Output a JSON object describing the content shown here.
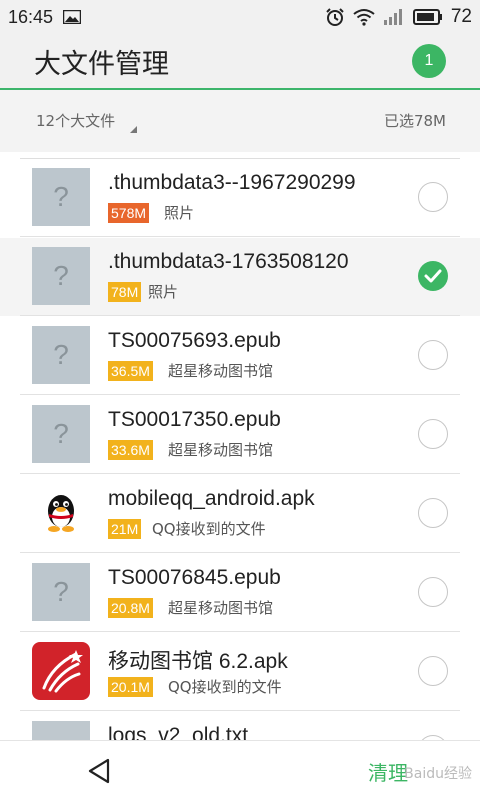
{
  "status_bar": {
    "time": "16:45",
    "battery": "72",
    "icons": [
      "image-icon",
      "alarm-icon",
      "wifi-icon",
      "signal-icon",
      "battery-icon"
    ]
  },
  "header": {
    "title": "大文件管理",
    "badge_count": "1"
  },
  "summary": {
    "file_count_label": "12个大文件",
    "selected_label": "已选78M"
  },
  "files": [
    {
      "name": ".thumbdata3--1967290299",
      "size": "578M",
      "size_color": "#e8662c",
      "source": "照片",
      "icon": "unknown-file-icon",
      "checked": false
    },
    {
      "name": ".thumbdata3-1763508120",
      "size": "78M",
      "size_color": "#f2b21c",
      "source": "照片",
      "icon": "unknown-file-icon",
      "checked": true
    },
    {
      "name": "TS00075693.epub",
      "size": "36.5M",
      "size_color": "#f2b21c",
      "source": "超星移动图书馆",
      "icon": "unknown-file-icon",
      "checked": false
    },
    {
      "name": "TS00017350.epub",
      "size": "33.6M",
      "size_color": "#f2b21c",
      "source": "超星移动图书馆",
      "icon": "unknown-file-icon",
      "checked": false
    },
    {
      "name": "mobileqq_android.apk",
      "size": "21M",
      "size_color": "#f2b21c",
      "source": "QQ接收到的文件",
      "icon": "qq-penguin-icon",
      "checked": false
    },
    {
      "name": "TS00076845.epub",
      "size": "20.8M",
      "size_color": "#f2b21c",
      "source": "超星移动图书馆",
      "icon": "unknown-file-icon",
      "checked": false
    },
    {
      "name": "移动图书馆 6.2.apk",
      "size": "20.1M",
      "size_color": "#f2b21c",
      "source": "QQ接收到的文件",
      "icon": "chaoxing-app-icon",
      "checked": false
    },
    {
      "name": "logs_v2_old.txt",
      "size": "",
      "size_color": "#f2b21c",
      "source": "",
      "icon": "text-file-icon",
      "checked": false
    }
  ],
  "bottom_nav": {
    "clean_label": "清理",
    "watermark": "Baidu经验"
  },
  "colors": {
    "accent": "#3cb664",
    "size_orange": "#e8662c",
    "size_yellow": "#f2b21c"
  }
}
